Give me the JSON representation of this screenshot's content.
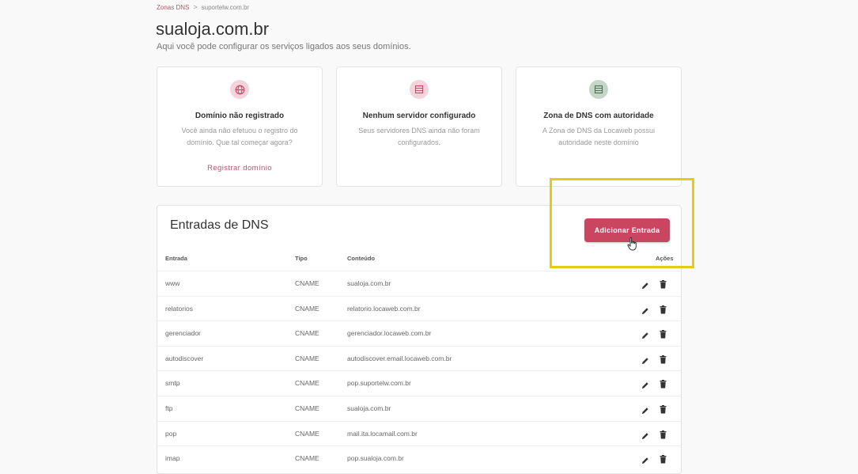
{
  "breadcrumb": {
    "parent": "Zonas DNS",
    "separator": ">",
    "current": "suportelw.com.br"
  },
  "page": {
    "title": "sualoja.com.br",
    "subtitle": "Aqui você pode configurar os serviços ligados aos seus domínios."
  },
  "cards": [
    {
      "title": "Domínio não registrado",
      "description": "Você ainda não efetuou o registro do domínio. Que tal começar agora?",
      "link": "Registrar domínio",
      "icon": "globe-icon",
      "color": "#f3d3dc"
    },
    {
      "title": "Nenhum servidor configurado",
      "description": "Seus servidores DNS ainda não foram configurados.",
      "icon": "server-icon",
      "color": "#f3d3dc"
    },
    {
      "title": "Zona de DNS com autoridade",
      "description": "A Zona de DNS da Locaweb possui autoridade neste domínio",
      "icon": "server-icon",
      "color": "#c4d6c6"
    }
  ],
  "dns": {
    "title": "Entradas de DNS",
    "add_button": "Adicionar Entrada",
    "accent": "#c94560",
    "highlight": "#e8c914",
    "columns": {
      "entry": "Entrada",
      "type": "Tipo",
      "content": "Conteúdo",
      "actions": "Ações"
    },
    "rows": [
      {
        "entry": "www",
        "type": "CNAME",
        "content": "sualoja.com.br"
      },
      {
        "entry": "relatorios",
        "type": "CNAME",
        "content": "relatorio.locaweb.com.br"
      },
      {
        "entry": "gerenciador",
        "type": "CNAME",
        "content": "gerenciador.locaweb.com.br"
      },
      {
        "entry": "autodiscover",
        "type": "CNAME",
        "content": "autodiscover.email.locaweb.com.br"
      },
      {
        "entry": "smtp",
        "type": "CNAME",
        "content": "pop.suportelw.com.br"
      },
      {
        "entry": "ftp",
        "type": "CNAME",
        "content": "sualoja.com.br"
      },
      {
        "entry": "pop",
        "type": "CNAME",
        "content": "mail.ita.locamail.com.br"
      },
      {
        "entry": "imap",
        "type": "CNAME",
        "content": "pop.sualoja.com.br"
      }
    ]
  }
}
